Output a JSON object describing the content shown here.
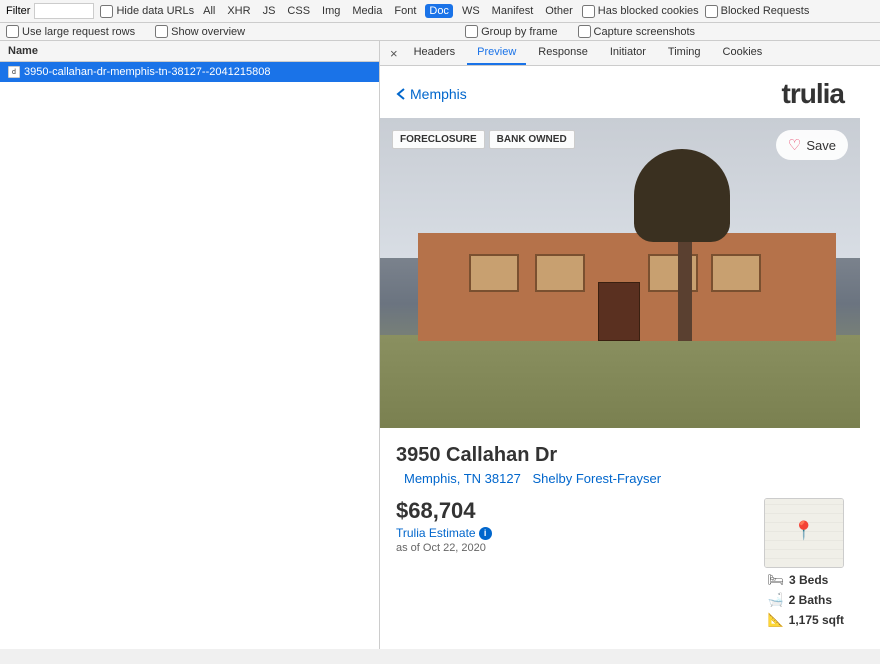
{
  "toolbar": {
    "filter_placeholder": "Filter",
    "hide_data_urls_label": "Hide data URLs",
    "all_label": "All",
    "xhr_label": "XHR",
    "js_label": "JS",
    "css_label": "CSS",
    "img_label": "Img",
    "media_label": "Media",
    "font_label": "Font",
    "doc_label": "Doc",
    "ws_label": "WS",
    "manifest_label": "Manifest",
    "other_label": "Other",
    "has_blocked_cookies_label": "Has blocked cookies",
    "blocked_requests_label": "Blocked Requests",
    "use_large_rows_label": "Use large request rows",
    "show_overview_label": "Show overview",
    "group_by_frame_label": "Group by frame",
    "capture_screenshots_label": "Capture screenshots"
  },
  "network_panel": {
    "header_name": "Name",
    "items": [
      {
        "name": "3950-callahan-dr-memphis-tn-38127--2041215808",
        "selected": true
      }
    ]
  },
  "detail_tabs": {
    "tabs": [
      {
        "label": "Headers",
        "active": false
      },
      {
        "label": "Preview",
        "active": true
      },
      {
        "label": "Response",
        "active": false
      },
      {
        "label": "Initiator",
        "active": false
      },
      {
        "label": "Timing",
        "active": false
      },
      {
        "label": "Cookies",
        "active": false
      }
    ]
  },
  "preview": {
    "back_label": "Memphis",
    "logo": "trulia",
    "badges": [
      "FORECLOSURE",
      "BANK OWNED"
    ],
    "save_label": "Save",
    "address": "3950 Callahan Dr",
    "city": "Memphis, TN 38127",
    "neighborhood": "Shelby Forest-Frayser",
    "price": "$68,704",
    "estimate_label": "Trulia Estimate",
    "estimate_date": "as of Oct 22, 2020",
    "beds": "3 Beds",
    "baths": "2 Baths",
    "sqft": "1,175 sqft"
  },
  "colors": {
    "accent": "#1a73e8",
    "selected_bg": "#1a73e8",
    "link": "#0066cc",
    "heart": "#e8446a",
    "badge_text": "#333"
  }
}
